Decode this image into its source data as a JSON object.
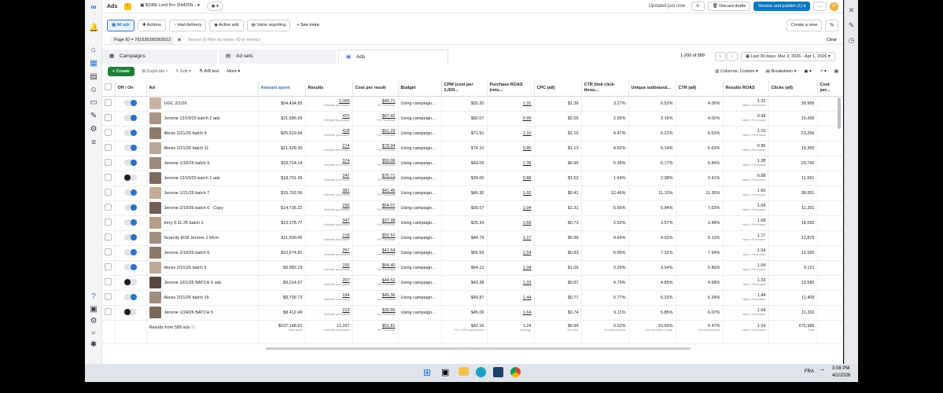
{
  "app": {
    "title": "Ads",
    "account": "$100k Limit Pro (544209...",
    "updated": "Updated just now",
    "discard": "Discard drafts",
    "review": "Review and publish (1)",
    "more": "...",
    "avatar": "H"
  },
  "views": {
    "all_ads": "All ads",
    "actions": "Actions",
    "had_delivery": "Had delivery",
    "active_ads": "Active ads",
    "value_reporting": "Value reporting",
    "see_more": "+ See more",
    "create_view": "Create a view"
  },
  "filter": {
    "pill": "Page ID = 761636290363012",
    "placeholder": "Search to filter by name, ID or metrics",
    "clear": "Clear"
  },
  "tabs": {
    "campaigns": "Campaigns",
    "adsets": "Ad sets",
    "ads": "Ads"
  },
  "paging": {
    "range": "1-200 of 589",
    "date": "Last 30 days: Mar 3, 2026 - Apr 1, 2026"
  },
  "toolbar": {
    "create": "+ Create",
    "duplicate": "Duplicate",
    "edit": "Edit",
    "ab": "A/B test",
    "more": "More",
    "columns": "Columns: Custom",
    "breakdown": "Breakdown"
  },
  "columns": [
    "Off / On",
    "Ad",
    "Amount spent",
    "Results",
    "Cost per result",
    "Budget",
    "CPM (cost per 1,000...",
    "Purchase ROAS (retu...",
    "CPC (all)",
    "CTR (link click-throu...",
    "Unique outbound...",
    "CTR (all)",
    "Results ROAS",
    "Clicks (all)",
    "Cost per..."
  ],
  "rows": [
    {
      "on": true,
      "name": "UGC 2/1/26",
      "spent": "$54,434.55",
      "results": "1,095",
      "cost": "$49.71",
      "budget": "Using campaign...",
      "cpm": "$55.20",
      "roas": "1.31",
      "cpc": "$1.36",
      "ctr_link": "3.27%",
      "unique": "6.52%",
      "ctr_all": "4.06%",
      "results_roas": "1.31",
      "clicks": "39,995"
    },
    {
      "on": true,
      "name": "Jerome 12/19/25 batch 2 ads",
      "spent": "$31,685.99",
      "results": "470",
      "cost": "$67.42",
      "budget": "Using campaign...",
      "cpm": "$82.07",
      "roas": "0.99",
      "cpc": "$2.05",
      "ctr_link": "2.55%",
      "unique": "3.16%",
      "ctr_all": "4.00%",
      "results_roas": "0.99",
      "clicks": "15,430"
    },
    {
      "on": true,
      "name": "Alexis 2/21/26 batch 9",
      "spent": "$25,619.94",
      "results": "418",
      "cost": "$61.29",
      "budget": "Using campaign...",
      "cpm": "$71.91",
      "roas": "1.10",
      "cpc": "$1.10",
      "ctr_link": "4.47%",
      "unique": "6.21%",
      "ctr_all": "6.53%",
      "results_roas": "1.10",
      "clicks": "23,256"
    },
    {
      "on": true,
      "name": "Alexis 2/21/26 batch 11",
      "spent": "$21,628.30",
      "results": "274",
      "cost": "$78.94",
      "budget": "Using campaign...",
      "cpm": "$74.10",
      "roas": "0.85",
      "cpc": "$1.12",
      "ctr_link": "4.62%",
      "unique": "6.14%",
      "ctr_all": "6.63%",
      "results_roas": "0.85",
      "clicks": "19,350"
    },
    {
      "on": true,
      "name": "Jerome 1/18/25 batch 9",
      "spent": "$18,724.14",
      "results": "374",
      "cost": "$50.06",
      "budget": "Using campaign...",
      "cpm": "$49.09",
      "roas": "1.38",
      "cpc": "$0.90",
      "ctr_link": "5.34%",
      "unique": "6.17%",
      "ctr_all": "5.44%",
      "results_roas": "1.38",
      "clicks": "20,742"
    },
    {
      "on": false,
      "name": "Jerome 12/15/25 batch 1 ads",
      "spent": "$18,701.39",
      "results": "247",
      "cost": "$75.71",
      "budget": "Using campaign...",
      "cpm": "$39.00",
      "roas": "0.88",
      "cpc": "$1.62",
      "ctr_link": "1.64%",
      "unique": "2.08%",
      "ctr_all": "2.41%",
      "results_roas": "0.88",
      "clicks": "11,561"
    },
    {
      "on": true,
      "name": "Jerome 1/21/25 batch 7",
      "spent": "$15,792.56",
      "results": "381",
      "cost": "$41.45",
      "budget": "Using campaign...",
      "cpm": "$46.30",
      "roas": "1.60",
      "cpc": "$0.41",
      "ctr_link": "12.45%",
      "unique": "11.10%",
      "ctr_all": "11.30%",
      "results_roas": "1.60",
      "clicks": "38,551"
    },
    {
      "on": true,
      "name": "Jerome 2/19/26 batch 6 - Copy",
      "spent": "$14,735.22",
      "results": "230",
      "cost": "$64.07",
      "budget": "Using campaign...",
      "cpm": "$99.57",
      "roas": "1.04",
      "cpc": "$1.31",
      "ctr_link": "5.55%",
      "unique": "5.94%",
      "ctr_all": "7.63%",
      "results_roas": "1.04",
      "clicks": "11,291"
    },
    {
      "on": true,
      "name": "torry 9.11.25 batch 1",
      "spent": "$13,178.77",
      "results": "347",
      "cost": "$37.98",
      "budget": "Using campaign...",
      "cpm": "$25.34",
      "roas": "1.68",
      "cpc": "$0.73",
      "ctr_link": "2.52%",
      "unique": "3.57%",
      "ctr_all": "3.48%",
      "results_roas": "1.68",
      "clicks": "18,092"
    },
    {
      "on": true,
      "name": "Scarcity 8/28 Jerome 2 bfcm",
      "spent": "$11,500.40",
      "results": "218",
      "cost": "$52.52",
      "budget": "Using campaign...",
      "cpm": "$44.79",
      "roas": "1.17",
      "cpc": "$0.88",
      "ctr_link": "4.64%",
      "unique": "4.62%",
      "ctr_all": "5.10%",
      "results_roas": "1.17",
      "clicks": "12,875"
    },
    {
      "on": true,
      "name": "Jerome 2/19/26 batch 6",
      "spent": "$10,674.81",
      "results": "257",
      "cost": "$41.54",
      "budget": "Using campaign...",
      "cpm": "$65.59",
      "roas": "1.54",
      "cpc": "$0.83",
      "ctr_link": "5.96%",
      "unique": "7.32%",
      "ctr_all": "7.94%",
      "results_roas": "1.54",
      "clicks": "12,930"
    },
    {
      "on": true,
      "name": "Alexis 2/21/26 batch 5",
      "spent": "$9,982.19",
      "results": "155",
      "cost": "$64.40",
      "budget": "Using campaign...",
      "cpm": "$64.12",
      "roas": "1.04",
      "cpc": "$1.09",
      "ctr_link": "3.29%",
      "unique": "3.54%",
      "ctr_all": "5.86%",
      "results_roas": "1.04",
      "clicks": "9,121"
    },
    {
      "on": false,
      "name": "Jerome 10/1/25 BATCH 6 ads",
      "spent": "$9,214.97",
      "results": "207",
      "cost": "$44.52",
      "budget": "Using campaign...",
      "cpm": "$43.38",
      "roas": "1.33",
      "cpc": "$0.87",
      "ctr_link": "4.79%",
      "unique": "4.85%",
      "ctr_all": "4.98%",
      "results_roas": "1.33",
      "clicks": "10,580"
    },
    {
      "on": true,
      "name": "Alexis 2/21/26 batch 16",
      "spent": "$8,799.73",
      "results": "194",
      "cost": "$45.36",
      "budget": "Using campaign...",
      "cpm": "$49.87",
      "roas": "1.44",
      "cpc": "$0.77",
      "ctr_link": "5.77%",
      "unique": "6.33%",
      "ctr_all": "6.34%",
      "results_roas": "1.44",
      "clicks": "11,409"
    },
    {
      "on": false,
      "name": "Jerome 1/24/26 BATCH 5",
      "spent": "$8,412.49",
      "results": "213",
      "cost": "$39.50",
      "budget": "Using campaign...",
      "cpm": "$45.09",
      "roas": "1.64",
      "cpc": "$0.74",
      "ctr_link": "6.11%",
      "unique": "5.85%",
      "ctr_all": "6.07%",
      "results_roas": "1.64",
      "clicks": "11,332"
    }
  ],
  "subs": {
    "results": "Website purchases",
    "cost": "Per Purchase",
    "results_roas": "Value, Purchases"
  },
  "totals": {
    "label": "Results from 589 ads",
    "spent": "$637,148.61",
    "spent_sub": "Total spent",
    "results": "12,297",
    "results_sub": "Website purchases",
    "cost": "$51.81",
    "cost_sub": "Per Purchase",
    "cpm": "$42.16",
    "cpm_sub": "Per 1,000 Impressions",
    "roas": "1.24",
    "roas_sub": "Average",
    "cpc": "$0.94",
    "cpc_sub": "Per Click",
    "ctr_link": "3.62%",
    "ctr_link_sub": "Per Impressions",
    "unique": "10.60%",
    "unique_sub": "Per Accounts Center",
    "ctr_all": "4.47%",
    "ctr_all_sub": "Per Impressions",
    "results_roas": "1.24",
    "results_roas_sub": "Value, Purchases",
    "clicks": "675,989",
    "clicks_sub": "Total"
  },
  "system": {
    "lang": "FRA",
    "time": "3:08 PM",
    "date": "4/2/2026"
  }
}
